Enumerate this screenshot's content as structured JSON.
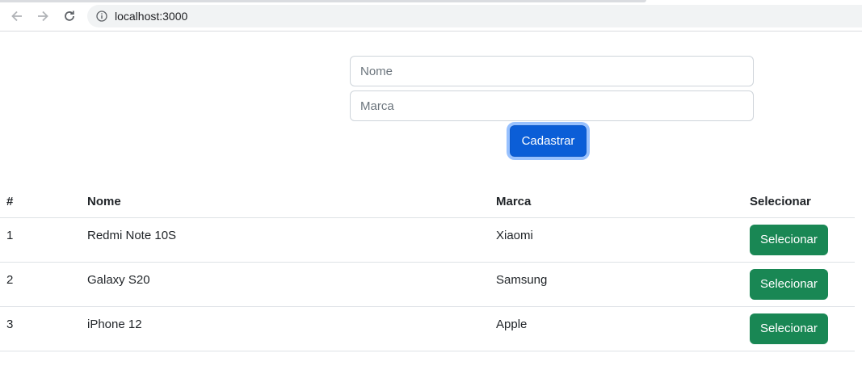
{
  "browser": {
    "url": "localhost:3000",
    "icons": {
      "back": "arrow-left-icon",
      "forward": "arrow-right-icon",
      "reload": "reload-icon",
      "info": "info-icon"
    }
  },
  "form": {
    "nome_placeholder": "Nome",
    "marca_placeholder": "Marca",
    "submit_label": "Cadastrar"
  },
  "table": {
    "headers": {
      "id": "#",
      "nome": "Nome",
      "marca": "Marca",
      "action": "Selecionar"
    },
    "rows": [
      {
        "id": "1",
        "nome": "Redmi Note 10S",
        "marca": "Xiaomi",
        "action": "Selecionar"
      },
      {
        "id": "2",
        "nome": "Galaxy S20",
        "marca": "Samsung",
        "action": "Selecionar"
      },
      {
        "id": "3",
        "nome": "iPhone 12",
        "marca": "Apple",
        "action": "Selecionar"
      }
    ]
  },
  "colors": {
    "primary": "#0b5ed7",
    "success": "#198754",
    "border": "#dee2e6"
  }
}
